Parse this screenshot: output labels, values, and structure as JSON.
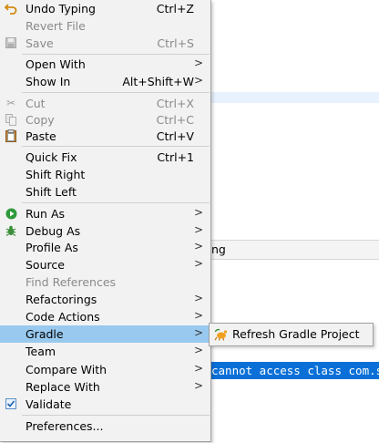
{
  "background": {
    "tab_fragment": "ng",
    "console_text": "cannot access class com.su"
  },
  "menu": [
    {
      "label": "Undo Typing",
      "accel": "Ctrl+Z",
      "icon": "undo-arrow-icon",
      "enabled": true
    },
    {
      "label": "Revert File",
      "accel": "",
      "enabled": false
    },
    {
      "label": "Save",
      "accel": "Ctrl+S",
      "icon": "save-disk-icon",
      "enabled": false
    },
    {
      "label": "Open With",
      "accel": "",
      "submenu": true,
      "enabled": true
    },
    {
      "label": "Show In",
      "accel": "Alt+Shift+W",
      "submenu": true,
      "enabled": true
    },
    {
      "label": "Cut",
      "accel": "Ctrl+X",
      "icon": "scissors-icon",
      "enabled": false
    },
    {
      "label": "Copy",
      "accel": "Ctrl+C",
      "icon": "copy-icon",
      "enabled": false
    },
    {
      "label": "Paste",
      "accel": "Ctrl+V",
      "icon": "clipboard-icon",
      "enabled": true
    },
    {
      "label": "Quick Fix",
      "accel": "Ctrl+1",
      "enabled": true
    },
    {
      "label": "Shift Right",
      "accel": "",
      "enabled": true
    },
    {
      "label": "Shift Left",
      "accel": "",
      "enabled": true
    },
    {
      "label": "Run As",
      "accel": "",
      "icon": "run-play-icon",
      "submenu": true,
      "enabled": true
    },
    {
      "label": "Debug As",
      "accel": "",
      "icon": "debug-bug-icon",
      "submenu": true,
      "enabled": true
    },
    {
      "label": "Profile As",
      "accel": "",
      "submenu": true,
      "enabled": true
    },
    {
      "label": "Source",
      "accel": "",
      "submenu": true,
      "enabled": true
    },
    {
      "label": "Find References",
      "accel": "",
      "enabled": false
    },
    {
      "label": "Refactorings",
      "accel": "",
      "submenu": true,
      "enabled": true
    },
    {
      "label": "Code Actions",
      "accel": "",
      "submenu": true,
      "enabled": true
    },
    {
      "label": "Gradle",
      "accel": "",
      "submenu": true,
      "enabled": true,
      "active": true
    },
    {
      "label": "Team",
      "accel": "",
      "submenu": true,
      "enabled": true
    },
    {
      "label": "Compare With",
      "accel": "",
      "submenu": true,
      "enabled": true
    },
    {
      "label": "Replace With",
      "accel": "",
      "submenu": true,
      "enabled": true
    },
    {
      "label": "Validate",
      "accel": "",
      "icon": "checkbox-checked-icon",
      "enabled": true,
      "checked": true
    },
    {
      "label": "Preferences...",
      "accel": "",
      "enabled": true
    }
  ],
  "submenu": {
    "label": "Refresh Gradle Project",
    "icon": "refresh-gradle-icon"
  },
  "colors": {
    "menu_bg": "#f2f2f2",
    "highlight": "#99c9ef",
    "console_selection": "#0a70d8",
    "disabled_text": "#8a8a8a"
  }
}
